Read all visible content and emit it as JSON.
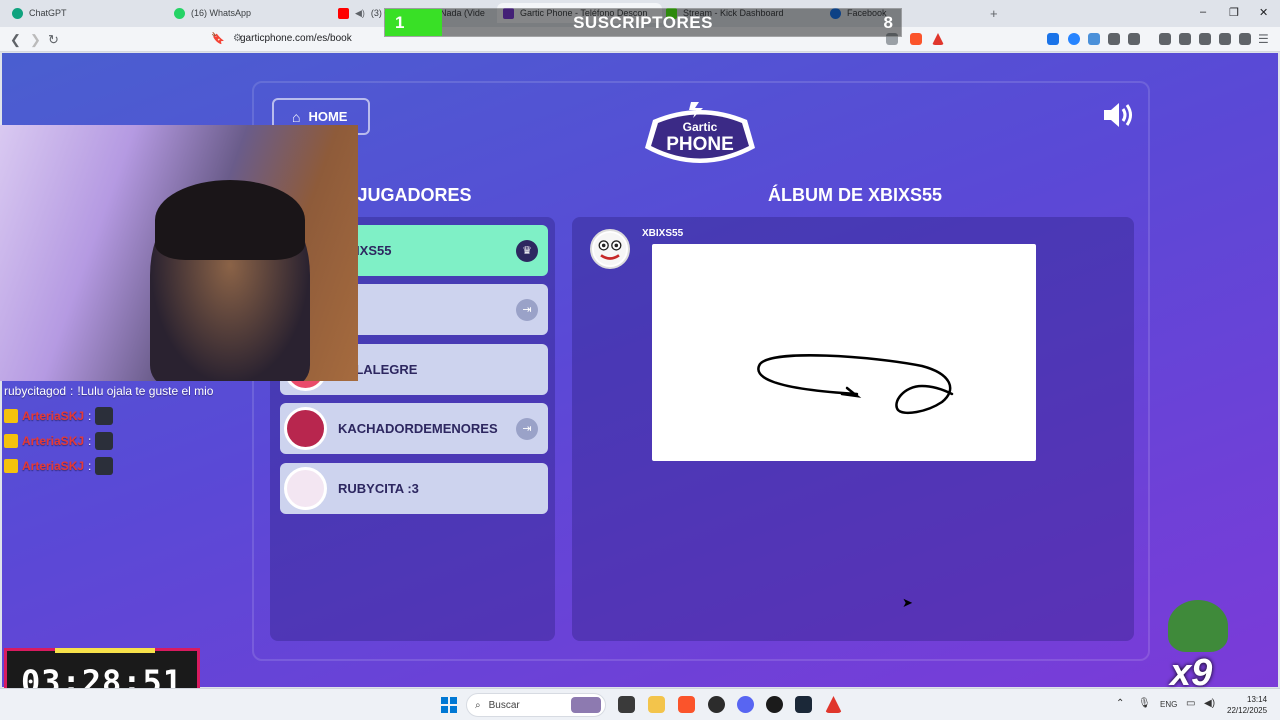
{
  "browser": {
    "tabs": [
      {
        "label": "ChatGPT",
        "icon": "chatgpt-icon",
        "color": "#10a37f"
      },
      {
        "label": "(16) WhatsApp",
        "icon": "whatsapp-icon",
        "color": "#25d366"
      },
      {
        "label": "(3) O",
        "icon": "youtube-icon",
        "color": "#ff0000"
      },
      {
        "label": "Nada (Vide",
        "icon": "video-icon",
        "color": "#888888"
      },
      {
        "label": "Gartic Phone - Teléfono Descon",
        "icon": "gartic-icon",
        "color": "#7b3bd8"
      },
      {
        "label": "Stream - Kick Dashboard",
        "icon": "kick-icon",
        "color": "#53fc18"
      },
      {
        "label": "Facebook",
        "icon": "facebook-icon",
        "color": "#1877f2"
      }
    ],
    "url": "garticphone.com/es/book",
    "new_tab": "+",
    "window_controls": {
      "minimize": "–",
      "maximize": "❐",
      "close": "✕"
    }
  },
  "subscriber_goal": {
    "current": "1",
    "label": "SUSCRIPTORES",
    "goal": "8",
    "progress_fraction": 0.11,
    "fill_color": "#39e026"
  },
  "game": {
    "home_label": "HOME",
    "logo_top": "Gartic",
    "logo_bottom": "PHONE",
    "players_title": "JUGADORES",
    "album_title": "ÁLBUM DE XBIXS55",
    "players": [
      {
        "name": "XBIXS55",
        "host": true,
        "icon": "crown-icon"
      },
      {
        "name": "",
        "host": false,
        "icon": "exit-icon"
      },
      {
        "name": "YELALEGRE",
        "host": false,
        "icon": ""
      },
      {
        "name": "KACHADORDEMENORES",
        "host": false,
        "icon": "exit-icon"
      },
      {
        "name": "RUBYCITA :3",
        "host": false,
        "icon": ""
      }
    ],
    "album_entry": {
      "author": "XBIXS55",
      "avatar": "clown-avatar"
    },
    "accent_color": "#7ff0c6"
  },
  "overlay": {
    "chat": [
      {
        "user": "rubycitagod",
        "message": "!Lulu ojala te guste el mio"
      },
      {
        "user": "ArteriaSKJ",
        "message": ""
      },
      {
        "user": "ArteriaSKJ",
        "message": ""
      },
      {
        "user": "ArteriaSKJ",
        "message": ""
      }
    ],
    "chat_separator": " : ",
    "timer": "03:28:51",
    "multiplier": "x9"
  },
  "taskbar": {
    "search_placeholder": "Buscar",
    "language": "ENG",
    "time": "13:14",
    "date": "22/12/2025"
  }
}
